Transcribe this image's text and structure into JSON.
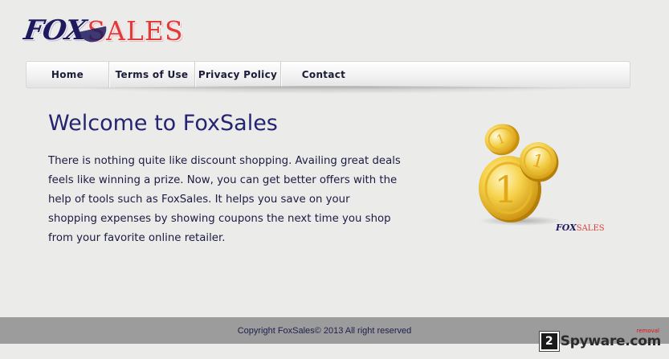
{
  "logo": {
    "part1": "FOX",
    "part2": "SALES"
  },
  "nav": {
    "items": [
      {
        "label": "Home"
      },
      {
        "label": "Terms of Use"
      },
      {
        "label": "Privacy Policy"
      },
      {
        "label": "Contact"
      }
    ]
  },
  "main": {
    "title": "Welcome to FoxSales",
    "paragraph": "There is nothing quite like discount shopping. Availing great deals feels like winning a prize. Now, you can get better offers with the help of tools such as FoxSales. It helps you save on your shopping expenses by showing coupons the next time you shop from your favorite online retailer."
  },
  "illustration": {
    "caption_part1": "FOX",
    "caption_part2": "SALES"
  },
  "footer": {
    "text": "Copyright FoxSales© 2013 All right reserved"
  },
  "watermark": {
    "badge": "2",
    "text": "Spyware.com",
    "tag": "removal"
  },
  "colors": {
    "title": "#242470",
    "accent_red": "#e03a3a",
    "brand_navy": "#1f1a5e",
    "footer_bg": "#9c9c9c",
    "gold": "#f2c230"
  }
}
